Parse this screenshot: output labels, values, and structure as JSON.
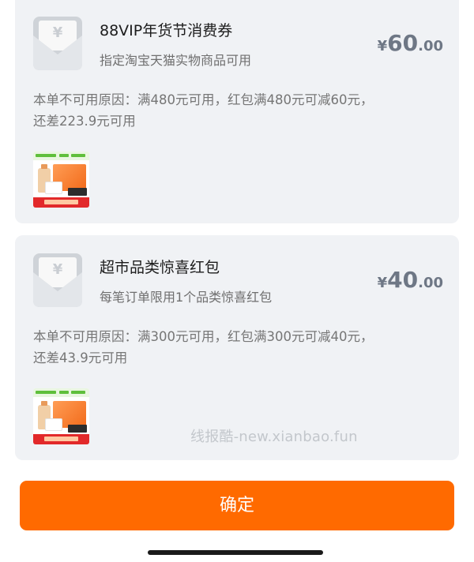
{
  "coupons": [
    {
      "title": "88VIP年货节消费券",
      "subtitle": "指定淘宝天猫实物商品可用",
      "amount": {
        "currency": "¥",
        "integer": "60",
        "decimal": ".00"
      },
      "reason_line1": "本单不可用原因：满480元可用，红包满480元可减60元，",
      "reason_line2": "还差223.9元可用"
    },
    {
      "title": "超市品类惊喜红包",
      "subtitle": "每笔订单限用1个品类惊喜红包",
      "amount": {
        "currency": "¥",
        "integer": "40",
        "decimal": ".00"
      },
      "reason_line1": "本单不可用原因：满300元可用，红包满300元可减40元，",
      "reason_line2": "还差43.9元可用"
    }
  ],
  "watermark": "线报酷-new.xianbao.fun",
  "confirm_label": "确定",
  "icons": {
    "envelope": "red-envelope-icon",
    "currency_symbol": "¥"
  },
  "colors": {
    "accent": "#ff6a00",
    "card_background": "#f0f2f5",
    "amount_text": "#6e7785"
  }
}
